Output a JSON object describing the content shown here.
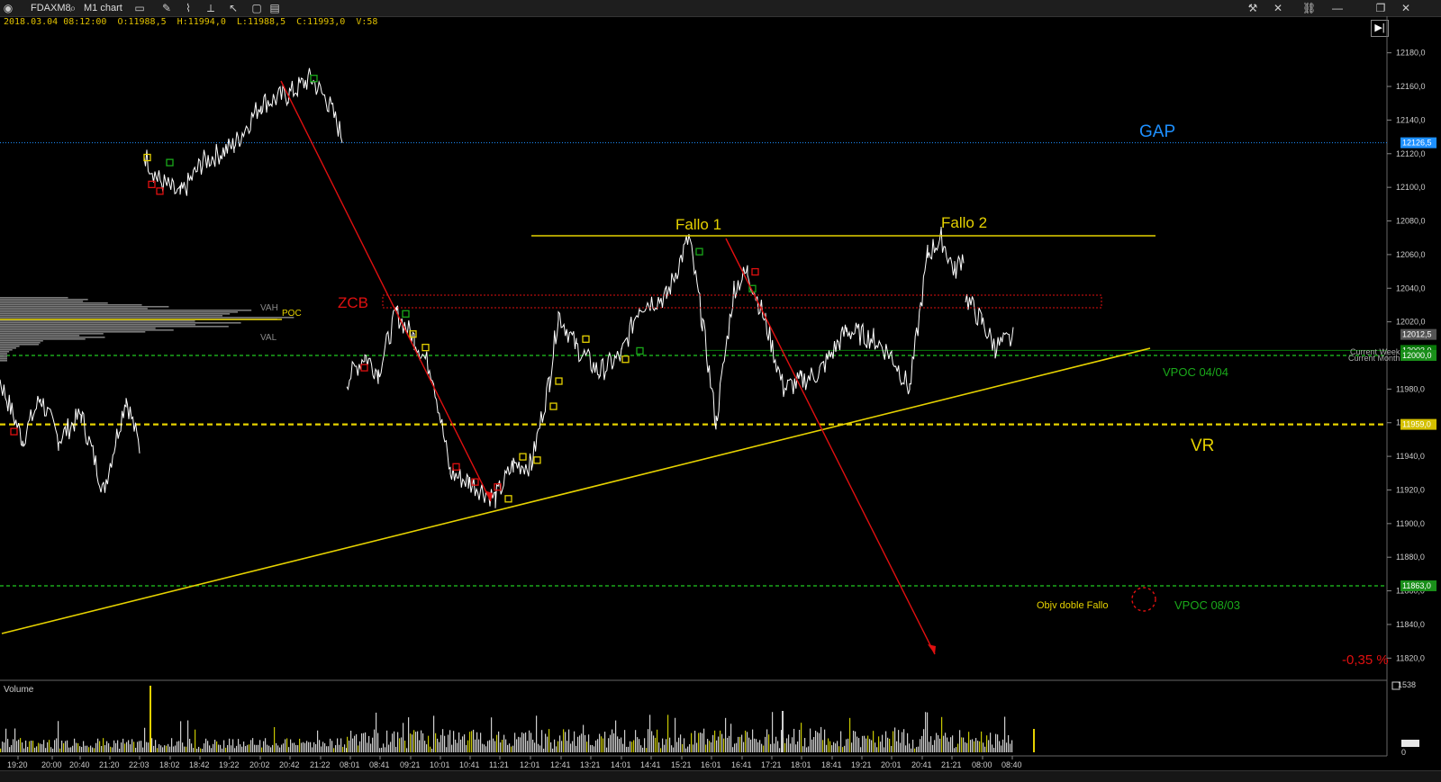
{
  "toolbar": {
    "symbol": "FDAXM8",
    "timeframe": "M1 chart",
    "window_buttons": [
      "—",
      "❐",
      "✕"
    ]
  },
  "ohlc": {
    "date": "2018.03.04 08:12:00",
    "open": "O:11988,5",
    "high": "H:11994,0",
    "low": "L:11988,5",
    "close": "C:11993,0",
    "volume": "V:58"
  },
  "price_axis": {
    "ticks": [
      "12180,0",
      "12160,0",
      "12140,0",
      "12120,0",
      "12100,0",
      "12080,0",
      "12060,0",
      "12040,0",
      "12020,0",
      "11980,0",
      "11960,0",
      "11940,0",
      "11920,0",
      "11900,0",
      "11880,0",
      "11860,0",
      "11840,0",
      "11820,0"
    ],
    "tick_values": [
      12180,
      12160,
      12140,
      12120,
      12100,
      12080,
      12060,
      12040,
      12020,
      11980,
      11960,
      11940,
      11920,
      11900,
      11880,
      11860,
      11840,
      11820
    ],
    "labels": [
      {
        "text": "12126,5",
        "value": 12126.5,
        "color": "#1e90ff"
      },
      {
        "text": "12012,5",
        "value": 12012.5,
        "color": "#555555"
      },
      {
        "text": "12003,0",
        "value": 12003,
        "color": "#0a7a0a"
      },
      {
        "text": "12000,0",
        "value": 12000,
        "color": "#1a8f1a"
      },
      {
        "text": "11959,0",
        "value": 11959,
        "color": "#d4c000"
      },
      {
        "text": "11863,0",
        "value": 11863,
        "color": "#1a8f1a"
      }
    ]
  },
  "time_axis": {
    "ticks": [
      "19:20",
      "20:00",
      "20:40",
      "21:20",
      "22:03",
      "18:02",
      "18:42",
      "19:22",
      "20:02",
      "20:42",
      "21:22",
      "08:01",
      "08:41",
      "09:21",
      "10:01",
      "10:41",
      "11:21",
      "12:01",
      "12:41",
      "13:21",
      "14:01",
      "14:41",
      "15:21",
      "16:01",
      "16:41",
      "17:21",
      "18:01",
      "18:41",
      "19:21",
      "20:01",
      "20:41",
      "21:21",
      "08:00",
      "08:40"
    ]
  },
  "levels": {
    "gap": {
      "label": "GAP",
      "price": 12126.5,
      "color": "#1e90ff"
    },
    "vpoc_0404": {
      "label": "VPOC 04/04",
      "price": 12000,
      "color": "#1aa81a"
    },
    "vr": {
      "label": "VR",
      "price": 11959,
      "color": "#e6d200"
    },
    "vpoc_0803": {
      "label": "VPOC 08/03",
      "price": 11863,
      "color": "#1aa81a"
    },
    "current_week": "Current Week",
    "current_month": "Current Month"
  },
  "annotations": {
    "fallo1": "Fallo 1",
    "fallo2": "Fallo 2",
    "zcb": "ZCB",
    "objetivo": "Objv doble Fallo",
    "pct": "-0,35 %",
    "vah": "VAH",
    "poc": "POC",
    "val": "VAL"
  },
  "volume": {
    "title": "Volume",
    "max_label": "1538",
    "zero_label": "0"
  },
  "chart_data": {
    "type": "line",
    "instrument": "FDAXM8",
    "timeframe": "M1",
    "ylim": [
      11810,
      12190
    ],
    "segments": [
      {
        "name": "day1",
        "points": [
          [
            0,
            11985
          ],
          [
            25,
            11950
          ],
          [
            45,
            11975
          ],
          [
            65,
            11950
          ],
          [
            90,
            11965
          ],
          [
            115,
            11920
          ],
          [
            140,
            11975
          ],
          [
            155,
            11945
          ]
        ]
      },
      {
        "name": "day2",
        "points": [
          [
            160,
            12120
          ],
          [
            175,
            12105
          ],
          [
            200,
            12095
          ],
          [
            225,
            12115
          ],
          [
            260,
            12125
          ],
          [
            290,
            12150
          ],
          [
            320,
            12155
          ],
          [
            345,
            12165
          ],
          [
            365,
            12150
          ],
          [
            380,
            12130
          ]
        ]
      },
      {
        "name": "day3",
        "points": [
          [
            385,
            11985
          ],
          [
            405,
            12000
          ],
          [
            420,
            11990
          ],
          [
            440,
            12025
          ],
          [
            460,
            12010
          ],
          [
            480,
            11990
          ],
          [
            500,
            11930
          ],
          [
            520,
            11925
          ],
          [
            550,
            11915
          ],
          [
            570,
            11935
          ],
          [
            590,
            11935
          ],
          [
            610,
            11985
          ],
          [
            620,
            12025
          ],
          [
            640,
            12005
          ],
          [
            665,
            11990
          ],
          [
            690,
            12000
          ],
          [
            710,
            12030
          ],
          [
            740,
            12035
          ],
          [
            765,
            12070
          ],
          [
            780,
            12020
          ],
          [
            795,
            11960
          ],
          [
            815,
            12040
          ],
          [
            830,
            12050
          ],
          [
            850,
            12020
          ],
          [
            870,
            11980
          ],
          [
            890,
            11985
          ],
          [
            910,
            11990
          ],
          [
            940,
            12015
          ],
          [
            970,
            12010
          ],
          [
            990,
            12000
          ],
          [
            1010,
            11980
          ],
          [
            1030,
            12060
          ],
          [
            1045,
            12070
          ],
          [
            1060,
            12050
          ],
          [
            1070,
            12060
          ]
        ]
      },
      {
        "name": "day4",
        "points": [
          [
            1072,
            12035
          ],
          [
            1090,
            12020
          ],
          [
            1105,
            12005
          ],
          [
            1125,
            12010
          ]
        ]
      }
    ],
    "volume_max": 1538
  }
}
